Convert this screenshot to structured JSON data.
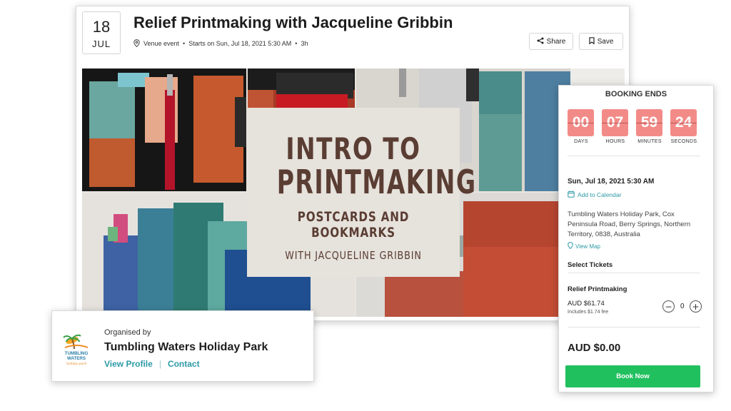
{
  "event": {
    "date_day": "18",
    "date_month": "JUL",
    "title": "Relief Printmaking with Jacqueline Gribbin",
    "meta": {
      "venue": "Venue event",
      "starts": "Starts on Sun, Jul 18, 2021 5:30 AM",
      "duration": "3h"
    },
    "share_label": "Share",
    "save_label": "Save"
  },
  "banner": {
    "line1": "INTRO TO",
    "line2": "PRINTMAKING",
    "line3": "POSTCARDS AND BOOKMARKS",
    "line4": "WITH JACQUELINE GRIBBIN"
  },
  "organiser": {
    "label": "Organised by",
    "name": "Tumbling Waters Holiday Park",
    "view_profile": "View Profile",
    "divider": "|",
    "contact": "Contact",
    "logo_text": {
      "line1": "TUMBLING",
      "line2": "WATERS",
      "line3": "holiday park"
    }
  },
  "booking": {
    "title": "BOOKING ENDS",
    "countdown": {
      "days": "00",
      "hours": "07",
      "minutes": "59",
      "seconds": "24",
      "days_label": "DAYS",
      "hours_label": "HOURS",
      "minutes_label": "MINUTES",
      "seconds_label": "SECONDS"
    },
    "date": "Sun, Jul 18, 2021 5:30 AM",
    "add_calendar": "Add to Calendar",
    "address": "Tumbling Waters Holiday Park, Cox Peninsula Road, Berry Springs, Northern Territory, 0838, Australia",
    "view_map": "View Map",
    "select_tickets": "Select Tickets",
    "ticket": {
      "name": "Relief Printmaking",
      "price": "AUD $61.74",
      "fee": "Includes $1.74 fee",
      "minus": "−",
      "quantity": "0",
      "plus": "+"
    },
    "total": "AUD $0.00",
    "book_label": "Book Now"
  },
  "colors": {
    "accent": "#2d9aa6",
    "countdown": "#f28b87",
    "book_button": "#21c05f",
    "banner_text": "#5a3d33"
  }
}
